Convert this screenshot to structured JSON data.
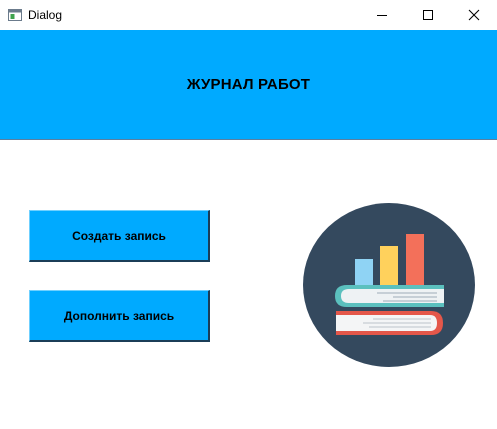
{
  "window": {
    "title": "Dialog",
    "icon": "app-window-icon",
    "controls": [
      "minimize-icon",
      "maximize-icon",
      "close-icon"
    ]
  },
  "header": {
    "title": "ЖУРНАЛ РАБОТ",
    "background": "#00aaff"
  },
  "buttons": {
    "create_label": "Создать запись",
    "append_label": "Дополнить запись",
    "background": "#00aaff"
  },
  "logo": {
    "icon": "books-chart-logo",
    "circle_color": "#34495e",
    "bar_colors": [
      "#8fd3f4",
      "#ffd15c",
      "#f3705a"
    ]
  }
}
